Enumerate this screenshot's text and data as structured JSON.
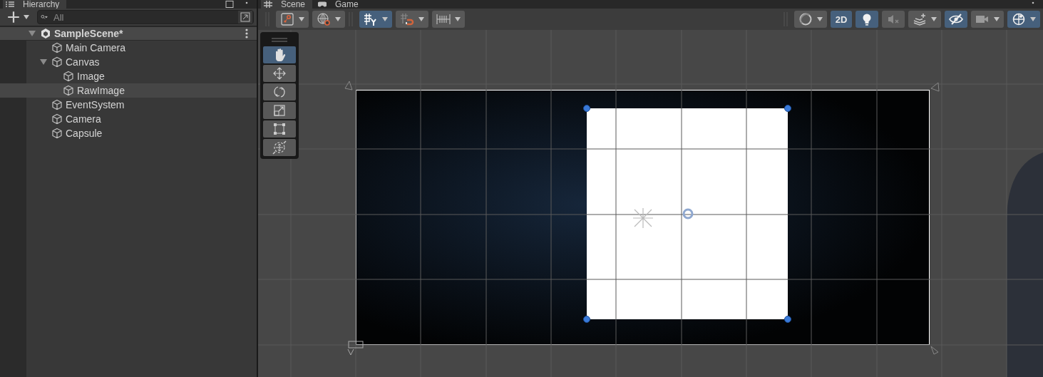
{
  "hierarchy": {
    "title": "Hierarchy",
    "search": {
      "placeholder": "All"
    },
    "tree": [
      {
        "label": "SampleScene*",
        "kind": "scene",
        "expanded": true,
        "selected": false,
        "children": [
          {
            "label": "Main Camera",
            "kind": "object",
            "selected": false
          },
          {
            "label": "Canvas",
            "kind": "object",
            "expanded": true,
            "selected": false,
            "children": [
              {
                "label": "Image",
                "kind": "object",
                "selected": false
              },
              {
                "label": "RawImage",
                "kind": "object",
                "selected": true
              }
            ]
          },
          {
            "label": "EventSystem",
            "kind": "object",
            "selected": false
          },
          {
            "label": "Camera",
            "kind": "object",
            "selected": false
          },
          {
            "label": "Capsule",
            "kind": "object",
            "selected": false
          }
        ]
      }
    ]
  },
  "scene": {
    "tabs": [
      {
        "label": "Scene",
        "kind": "scene",
        "selected": true
      },
      {
        "label": "Game",
        "kind": "game",
        "selected": false
      }
    ],
    "toolbar_left": [
      {
        "kind": "pivot",
        "on": false,
        "dropdown": true
      },
      {
        "kind": "globe",
        "on": false,
        "dropdown": true
      },
      {
        "kind": "separator"
      },
      {
        "kind": "grid",
        "on": true,
        "dropdown": true
      },
      {
        "kind": "snap",
        "on": false,
        "dropdown": true
      },
      {
        "kind": "increment",
        "on": false,
        "dropdown": true
      }
    ],
    "toolbar_right": [
      {
        "kind": "shading",
        "on": false,
        "dropdown": true
      },
      {
        "kind": "text",
        "label": "2D",
        "on": true,
        "dropdown": false
      },
      {
        "kind": "light",
        "on": true,
        "dropdown": false
      },
      {
        "kind": "audio",
        "on": false,
        "dropdown": false
      },
      {
        "kind": "effects",
        "on": false,
        "dropdown": true
      },
      {
        "kind": "visibility",
        "on": true,
        "dropdown": false
      },
      {
        "kind": "camera",
        "on": false,
        "dropdown": true
      },
      {
        "kind": "gizmos",
        "on": true,
        "dropdown": true
      }
    ],
    "tools": [
      {
        "kind": "hand",
        "selected": true
      },
      {
        "kind": "move",
        "selected": false
      },
      {
        "kind": "rotate",
        "selected": false
      },
      {
        "kind": "scale",
        "selected": false
      },
      {
        "kind": "rect",
        "selected": false
      },
      {
        "kind": "transform",
        "selected": false
      }
    ]
  }
}
